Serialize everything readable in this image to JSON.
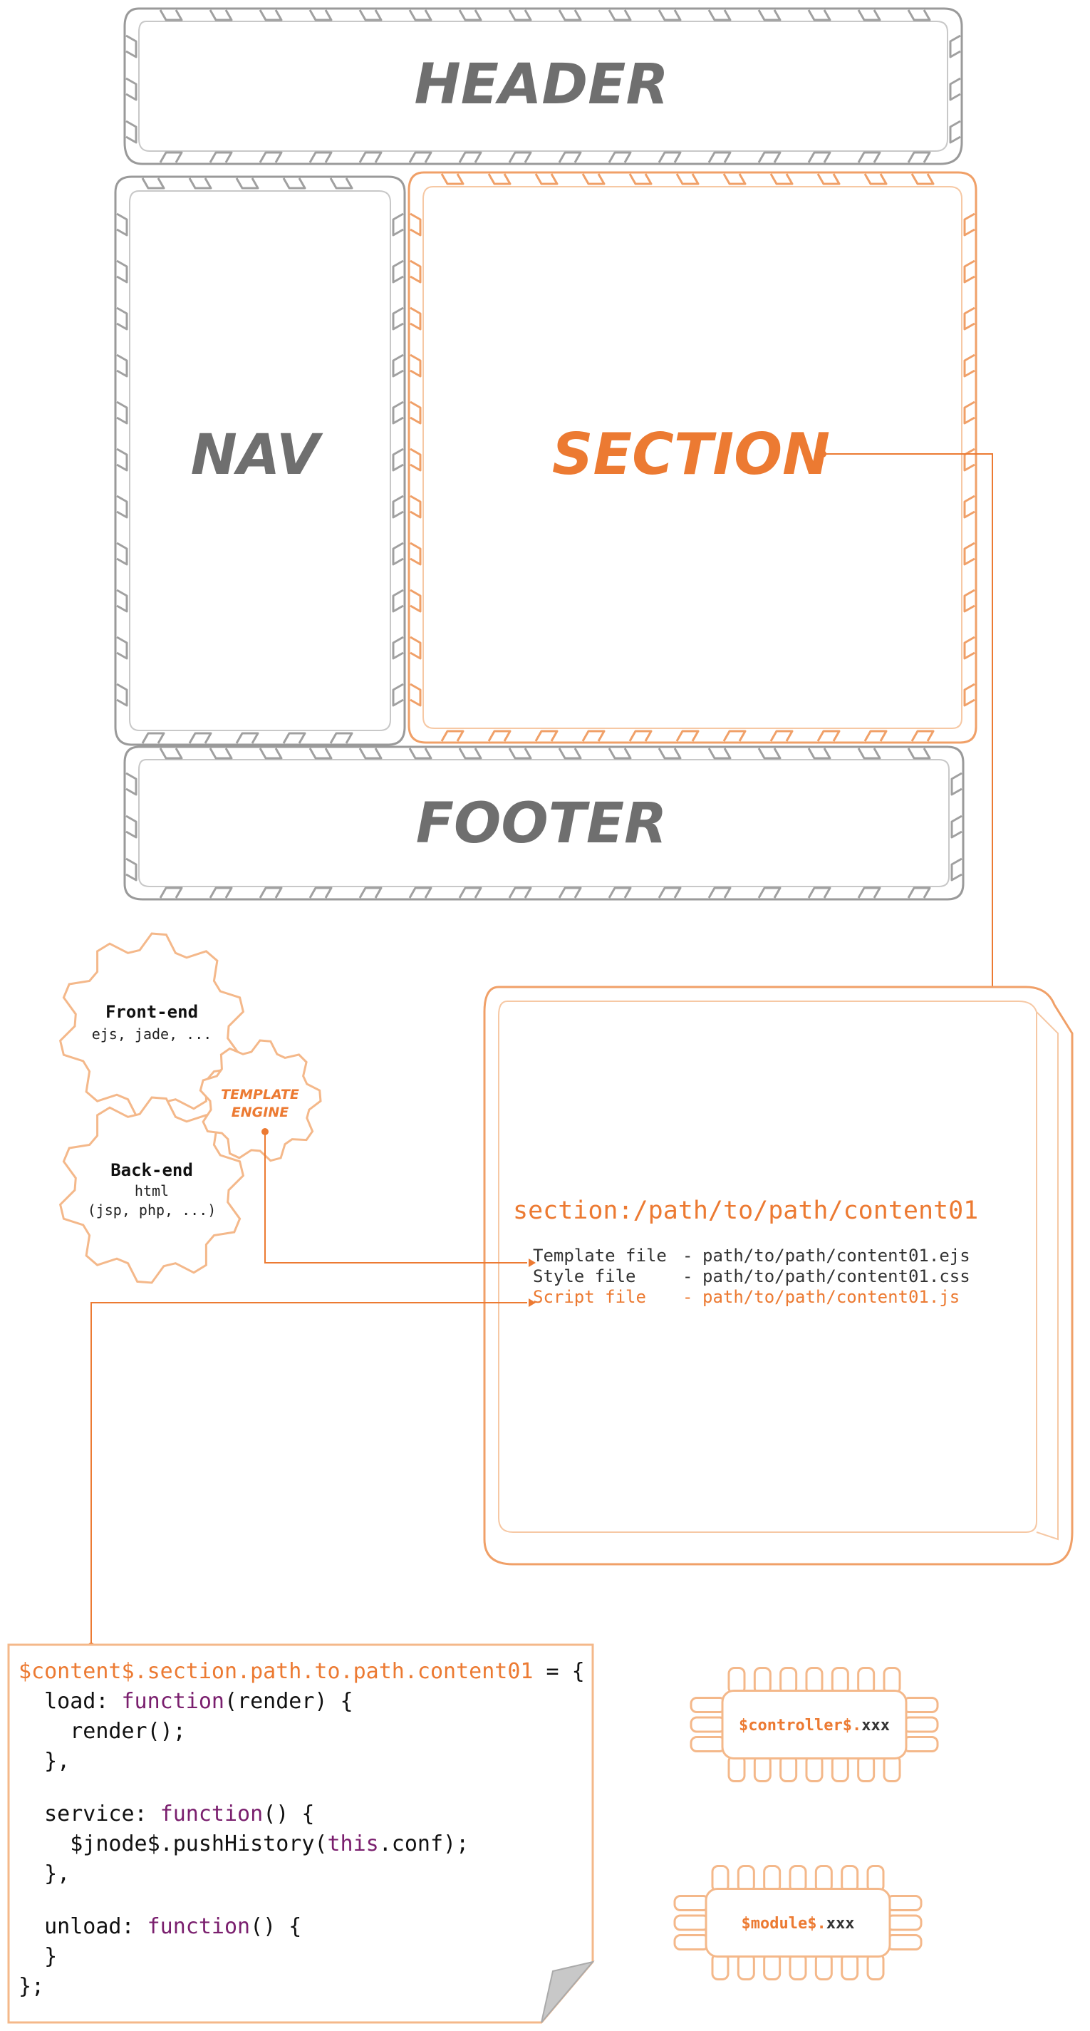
{
  "blocks": {
    "header": "HEADER",
    "nav": "NAV",
    "section": "SECTION",
    "footer": "FOOTER"
  },
  "gears": {
    "frontend": {
      "title": "Front-end",
      "sub": "ejs, jade, ..."
    },
    "backend": {
      "title": "Back-end",
      "sub1": "html",
      "sub2": "(jsp, php, ...)"
    },
    "template_engine": {
      "line1": "TEMPLATE",
      "line2": "ENGINE"
    }
  },
  "section_panel": {
    "path": "section:/path/to/path/content01",
    "files": [
      {
        "label": "Template file",
        "sep": "-",
        "value": "path/to/path/content01.ejs"
      },
      {
        "label": "Style file",
        "sep": "-",
        "value": "path/to/path/content01.css"
      },
      {
        "label": "Script file",
        "sep": "-",
        "value": "path/to/path/content01.js"
      }
    ]
  },
  "code": {
    "l1_var": "$content$.section.path.to.path.content01",
    "l1_rest": " = {",
    "l2_a": "  load: ",
    "l2_kw": "function",
    "l2_b": "(render) {",
    "l3": "    render();",
    "l4": "  },",
    "l5_a": "  service: ",
    "l5_kw": "function",
    "l5_b": "() {",
    "l6_a": "    $jnode$.pushHistory(",
    "l6_kw": "this",
    "l6_b": ".conf);",
    "l7": "  },",
    "l8_a": "  unload: ",
    "l8_kw": "function",
    "l8_b": "() {",
    "l9": "  }",
    "l10": "};"
  },
  "chips": {
    "controller_prefix": "$controller$.",
    "controller_suffix": "xxx",
    "module_prefix": "$module$.",
    "module_suffix": "xxx"
  },
  "colors": {
    "orange": "#ec7a32",
    "grey": "#777777",
    "keyword": "#7a1f6e"
  }
}
